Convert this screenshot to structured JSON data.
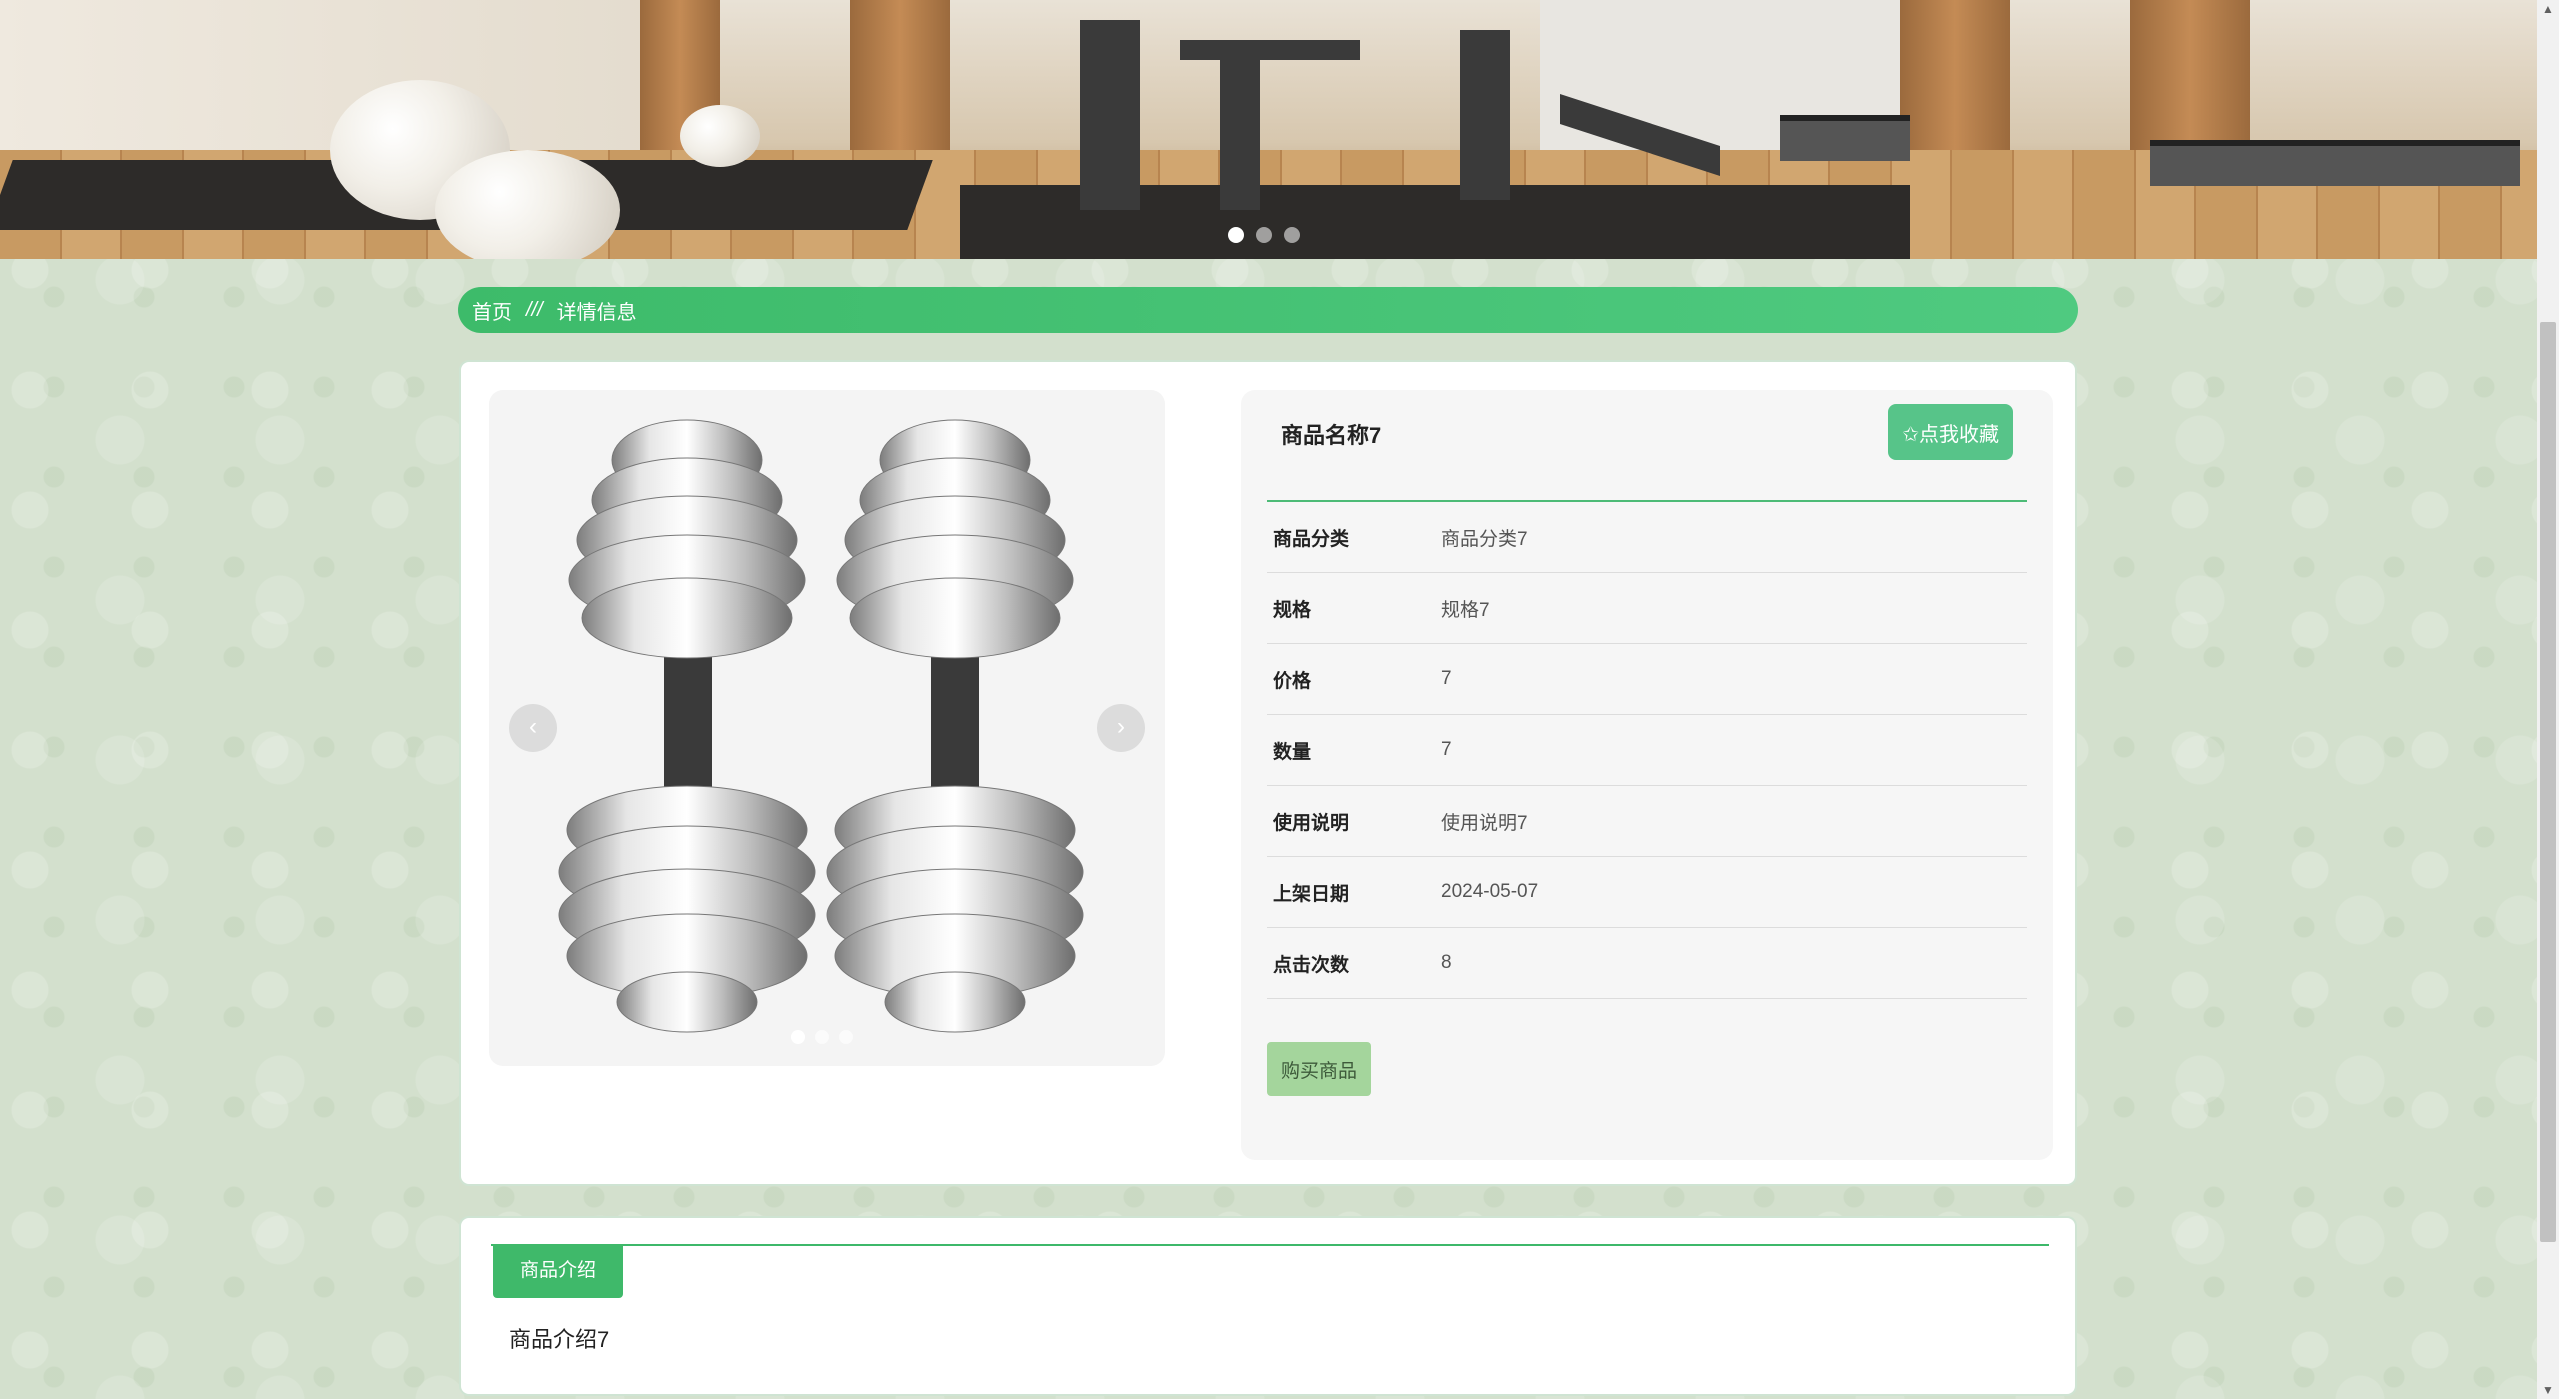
{
  "breadcrumb": {
    "home": "首页",
    "separator": "///",
    "current": "详情信息"
  },
  "product": {
    "name": "商品名称7",
    "favorite_label": "✩点我收藏",
    "fields": [
      {
        "label": "商品分类",
        "value": "商品分类7"
      },
      {
        "label": "规格",
        "value": "规格7"
      },
      {
        "label": "价格",
        "value": "7"
      },
      {
        "label": "数量",
        "value": "7"
      },
      {
        "label": "使用说明",
        "value": "使用说明7"
      },
      {
        "label": "上架日期",
        "value": "2024-05-07"
      },
      {
        "label": "点击次数",
        "value": "8"
      }
    ],
    "buy_label": "购买商品"
  },
  "intro": {
    "tab_label": "商品介绍",
    "content": "商品介绍7"
  },
  "icons": {
    "prev": "chevron-left-icon",
    "next": "chevron-right-icon",
    "favorite": "star-outline-icon"
  },
  "colors": {
    "accent": "#3fb96a",
    "favorite_button": "#57c489",
    "buy_button": "#a4d59c"
  }
}
